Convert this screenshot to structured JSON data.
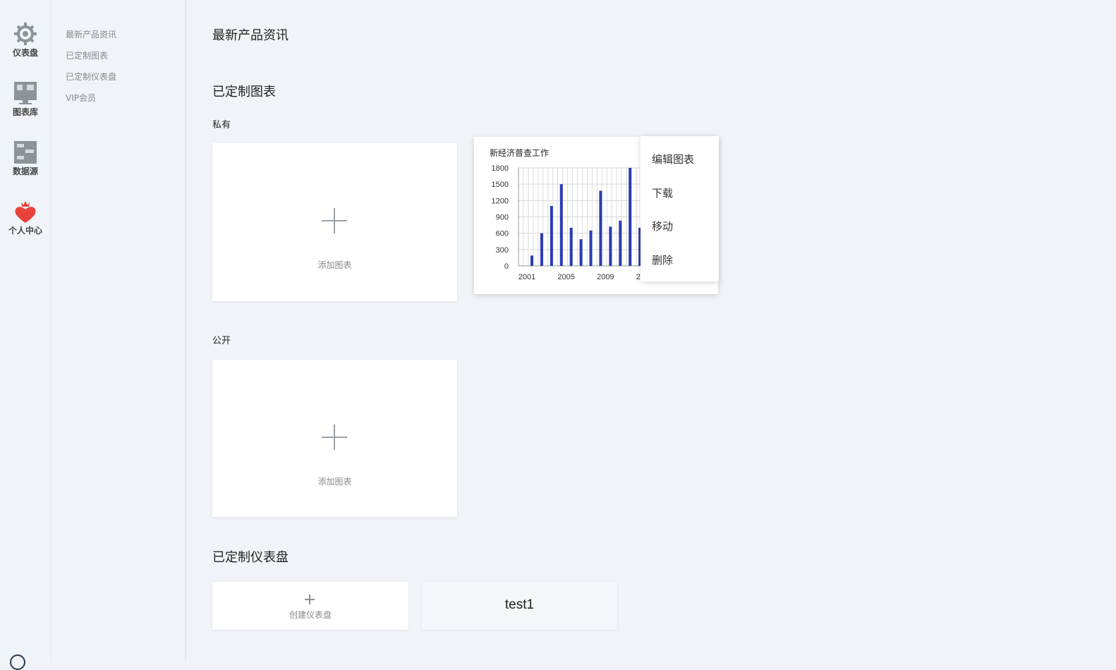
{
  "rail": {
    "items": [
      {
        "label": "仪表盘",
        "icon": "gear-icon"
      },
      {
        "label": "图表库",
        "icon": "chart-library-icon"
      },
      {
        "label": "数据源",
        "icon": "data-source-icon"
      },
      {
        "label": "个人中心",
        "icon": "heart-crown-icon"
      }
    ]
  },
  "subnav": {
    "items": [
      {
        "label": "最新产品资讯"
      },
      {
        "label": "已定制图表"
      },
      {
        "label": "已定制仪表盘"
      },
      {
        "label": "VIP会员"
      }
    ]
  },
  "main": {
    "news_title": "最新产品资讯",
    "charts_title": "已定制图表",
    "private_label": "私有",
    "public_label": "公开",
    "add_chart_label": "添加图表",
    "dashboards_title": "已定制仪表盘",
    "create_dashboard_label": "创建仪表盘",
    "dashboard_name": "test1"
  },
  "context_menu": {
    "items": [
      {
        "label": "编辑图表"
      },
      {
        "label": "下载"
      },
      {
        "label": "移动"
      },
      {
        "label": "删除"
      }
    ]
  },
  "colors": {
    "bar": "#2a3cb5",
    "accent_red": "#e8413c"
  },
  "chart_data": {
    "type": "bar",
    "title": "新经济普查工作",
    "x": [
      2001,
      2002,
      2003,
      2004,
      2005,
      2006,
      2007,
      2008,
      2009,
      2010,
      2011,
      2012,
      2013
    ],
    "values": [
      190,
      600,
      1100,
      1500,
      700,
      490,
      650,
      1380,
      720,
      830,
      1800,
      700,
      0
    ],
    "x_ticks": [
      "2001",
      "2005",
      "2009",
      "2013"
    ],
    "y_ticks": [
      "0",
      "300",
      "600",
      "900",
      "1200",
      "1500",
      "1800"
    ],
    "ylim": [
      0,
      1800
    ],
    "grid": true
  }
}
